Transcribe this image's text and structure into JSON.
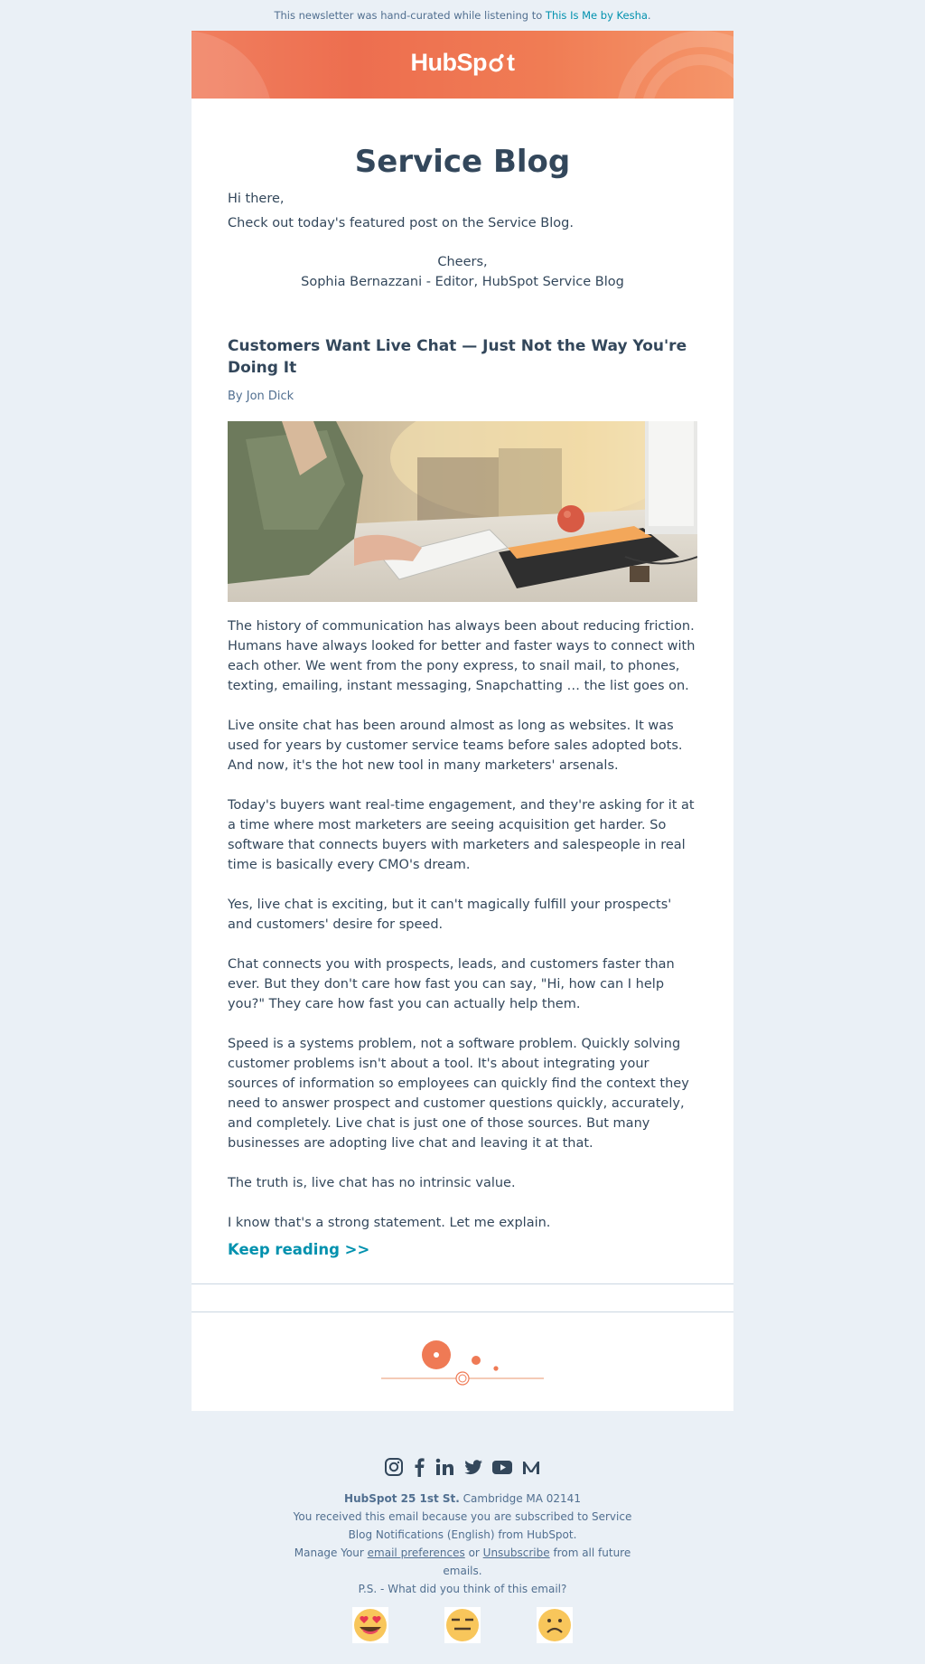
{
  "preheader": {
    "text": "This newsletter was hand-curated while listening to ",
    "link": "This Is Me by Kesha",
    "suffix": "."
  },
  "brand": {
    "logo_text_a": "HubSp",
    "logo_text_b": "t",
    "accent": "#ef7a55",
    "link_color": "#0091ae"
  },
  "header": {
    "title": "Service Blog",
    "greeting": "Hi there,",
    "intro": "Check out today's featured post on the Service Blog.",
    "signoff": "Cheers,",
    "signature": "Sophia Bernazzani - Editor, HubSpot Service Blog"
  },
  "post": {
    "title": "Customers Want Live Chat — Just Not the Way You're Doing It",
    "byline_prefix": "By ",
    "author": "Jon Dick",
    "image_alt": "person typing on a keyboard at a desk",
    "paragraphs": [
      "The history of communication has always been about reducing friction. Humans have always looked for better and faster ways to connect with each other. We went from the pony express, to snail mail, to phones, texting, emailing, instant messaging, Snapchatting … the list goes on.",
      "Live onsite chat has been around almost as long as websites. It was used for years by customer service teams before sales adopted bots. And now, it's the hot new tool in many marketers' arsenals.",
      "Today's buyers want real-time engagement, and they're asking for it at a time where most marketers are seeing acquisition get harder. So software that connects buyers with marketers and salespeople in real time is basically every CMO's dream.",
      "Yes, live chat is exciting, but it can't magically fulfill your prospects' and customers' desire for speed.",
      "Chat connects you with prospects, leads, and customers faster than ever. But they don't care how fast you can say, \"Hi, how can I help you?\" They care how fast you can actually help them.",
      "Speed is a systems problem, not a software problem. Quickly solving customer problems isn't about a tool. It's about integrating your sources of information so employees can quickly find the context they need to answer prospect and customer questions quickly, accurately, and completely. Live chat is just one of those sources. But many businesses are adopting live chat and leaving it at that.",
      "The truth is, live chat has no intrinsic value.",
      "I know that's a strong statement. Let me explain."
    ],
    "cta": "Keep reading >>"
  },
  "footer": {
    "social_icons": [
      "instagram-icon",
      "facebook-icon",
      "linkedin-icon",
      "twitter-icon",
      "youtube-icon",
      "medium-icon"
    ],
    "company": "HubSpot 25 1st St.",
    "city": " Cambridge MA 02141",
    "reason": "You received this email because you are subscribed to Service Blog Notifications (English) from HubSpot.",
    "manage_prefix": "Manage Your ",
    "preferences_link": "email preferences",
    "or": " or ",
    "unsubscribe_link": "Unsubscribe",
    "manage_suffix": " from all future emails.",
    "feedback_question": "P.S. - What did you think of this email?",
    "feedback_options": [
      "love-emoji",
      "neutral-emoji",
      "sad-emoji"
    ]
  }
}
